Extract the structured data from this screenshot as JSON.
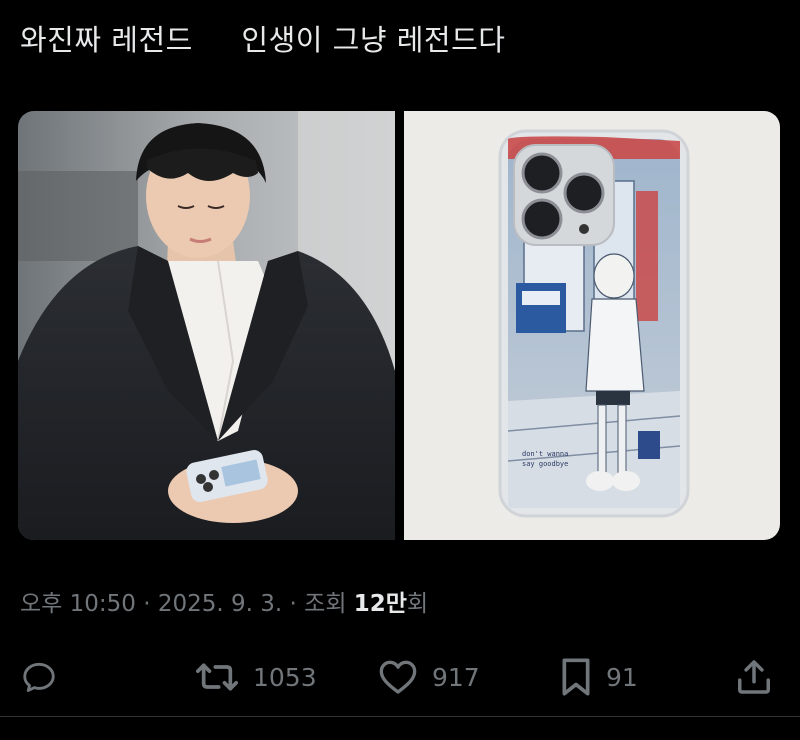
{
  "tweet": {
    "text": "와진짜 레전드     인생이 그냥 레전드다"
  },
  "media": {
    "left_image": "photo of a man in a black suit looking at a phone",
    "right_image": "illustrated clear phone case with a girl on a street"
  },
  "meta": {
    "time": "오후 10:50",
    "separator1": " · ",
    "date": "2025. 9. 3.",
    "separator2": " · ",
    "views_label": "조회 ",
    "views_count": "12만",
    "views_suffix": "회"
  },
  "actions": {
    "reply": {
      "icon": "reply-icon",
      "count": ""
    },
    "retweet": {
      "icon": "retweet-icon",
      "count": "1053"
    },
    "like": {
      "icon": "heart-icon",
      "count": "917"
    },
    "bookmark": {
      "icon": "bookmark-icon",
      "count": "91"
    },
    "share": {
      "icon": "share-icon"
    }
  },
  "colors": {
    "background": "#000000",
    "text_primary": "#e7e9ea",
    "text_secondary": "#71767b",
    "divider": "#2f3336"
  }
}
